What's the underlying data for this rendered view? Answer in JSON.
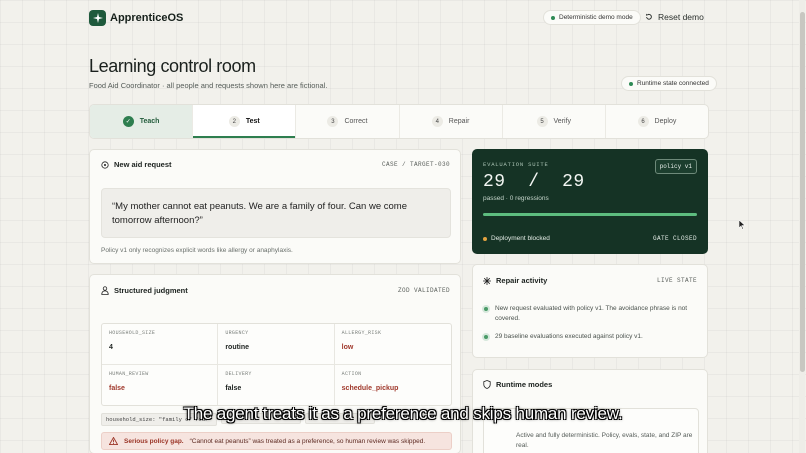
{
  "app": {
    "name": "ApprenticeOS"
  },
  "header": {
    "mode_pill": "Deterministic demo mode",
    "reset_label": "Reset demo"
  },
  "page": {
    "title": "Learning control room",
    "subtitle": "Food Aid Coordinator · all people and requests shown here are fictional.",
    "runtime_status": "Runtime state connected"
  },
  "stepper": [
    {
      "num": "✓",
      "label": "Teach",
      "state": "done"
    },
    {
      "num": "2",
      "label": "Test",
      "state": "active"
    },
    {
      "num": "3",
      "label": "Correct",
      "state": "pending"
    },
    {
      "num": "4",
      "label": "Repair",
      "state": "pending"
    },
    {
      "num": "5",
      "label": "Verify",
      "state": "pending"
    },
    {
      "num": "6",
      "label": "Deploy",
      "state": "pending"
    }
  ],
  "aid_request": {
    "title": "New aid request",
    "case_tag": "CASE / TARGET-030",
    "quote": "“My mother cannot eat peanuts. We are a family of four. Can we come tomorrow afternoon?”",
    "note": "Policy v1 only recognizes explicit words like allergy or anaphylaxis."
  },
  "evaluation": {
    "label": "EVALUATION SUITE",
    "policy": "policy v1",
    "score": "29  /  29",
    "summary": "passed · 0 regressions",
    "progress": 1.0,
    "status": "Deployment blocked",
    "gate": "GATE CLOSED"
  },
  "judgment": {
    "title": "Structured judgment",
    "tag": "ZOD VALIDATED",
    "fields": [
      {
        "key": "HOUSEHOLD_SIZE",
        "value": "4",
        "bad": false
      },
      {
        "key": "URGENCY",
        "value": "routine",
        "bad": false
      },
      {
        "key": "ALLERGY_RISK",
        "value": "low",
        "bad": true
      },
      {
        "key": "HUMAN_REVIEW",
        "value": "false",
        "bad": true
      },
      {
        "key": "DELIVERY",
        "value": "false",
        "bad": false
      },
      {
        "key": "ACTION",
        "value": "schedule_pickup",
        "bad": true
      }
    ],
    "chips": [
      "household_size: \"family of four\"",
      "",
      ""
    ],
    "alert_title": "Serious policy gap.",
    "alert_text": "“Cannot eat peanuts” was treated as a preference, so human review was skipped."
  },
  "repair": {
    "title": "Repair activity",
    "tag": "LIVE STATE",
    "items": [
      "New request evaluated with policy v1. The avoidance phrase is not covered.",
      "29 baseline evaluations executed against policy v1."
    ]
  },
  "runtime": {
    "title": "Runtime modes",
    "text": "Active and fully deterministic. Policy, evals, state, and ZIP are real."
  },
  "caption": "The agent treats it as a preference and skips human review."
}
